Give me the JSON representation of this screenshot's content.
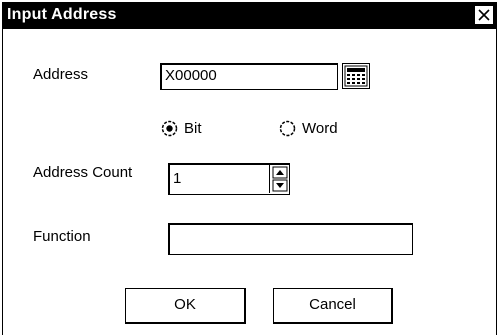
{
  "window": {
    "title": "Input Address",
    "close_glyph": "X"
  },
  "address": {
    "label": "Address",
    "value": "X00000",
    "picker_icon": "keypad-icon"
  },
  "type_options": [
    {
      "label": "Bit",
      "selected": true
    },
    {
      "label": "Word",
      "selected": false
    }
  ],
  "address_count": {
    "label": "Address Count",
    "value": "1"
  },
  "function": {
    "label": "Function",
    "value": ""
  },
  "buttons": {
    "ok": "OK",
    "cancel": "Cancel"
  }
}
